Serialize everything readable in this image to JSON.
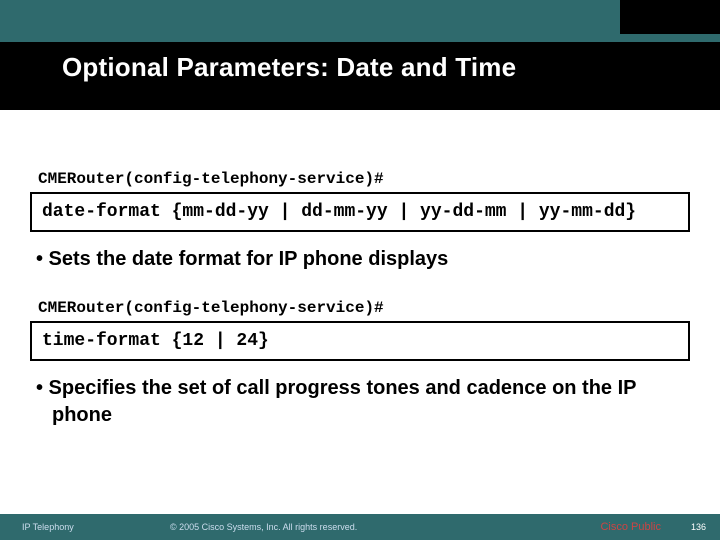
{
  "header": {
    "title": "Optional Parameters: Date and Time"
  },
  "block1": {
    "prompt": "CMERouter(config-telephony-service)#",
    "command": "date-format {mm-dd-yy | dd-mm-yy | yy-dd-mm | yy-mm-dd}",
    "bullet": "• Sets the date format for IP phone displays"
  },
  "block2": {
    "prompt": "CMERouter(config-telephony-service)#",
    "command": "time-format {12 | 24}",
    "bullet": "• Specifies the set of call progress tones and cadence on the IP phone"
  },
  "footer": {
    "left": "IP Telephony",
    "copyright": "© 2005 Cisco Systems, Inc. All rights reserved.",
    "public": "Cisco Public",
    "page": "136"
  }
}
